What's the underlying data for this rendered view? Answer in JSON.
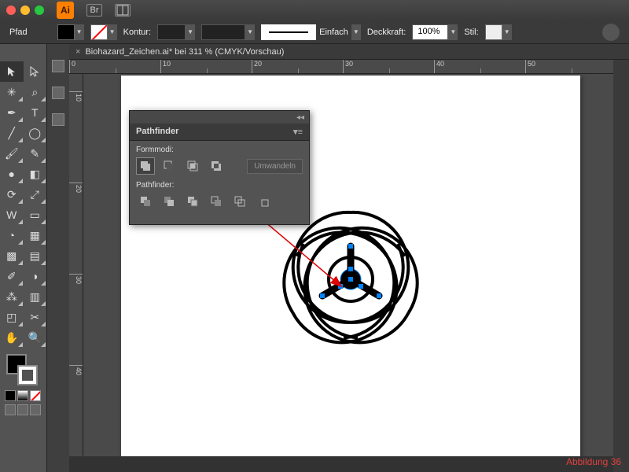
{
  "app": {
    "abbr": "Ai",
    "br_label": "Br"
  },
  "controlbar": {
    "path_label": "Pfad",
    "kontur_label": "Kontur:",
    "stroke_style": "Einfach",
    "deckkraft_label": "Deckkraft:",
    "opacity_value": "100%",
    "stil_label": "Stil:"
  },
  "tab": {
    "title": "Biohazard_Zeichen.ai* bei 311 % (CMYK/Vorschau)"
  },
  "ruler_h": [
    "0",
    "10",
    "20",
    "30",
    "40",
    "50"
  ],
  "ruler_v": [
    "10",
    "20",
    "30",
    "40"
  ],
  "pathfinder": {
    "title": "Pathfinder",
    "shape_label": "Formmodi:",
    "pf_label": "Pathfinder:",
    "convert_label": "Umwandeln"
  },
  "caption": "Abbildung  36"
}
